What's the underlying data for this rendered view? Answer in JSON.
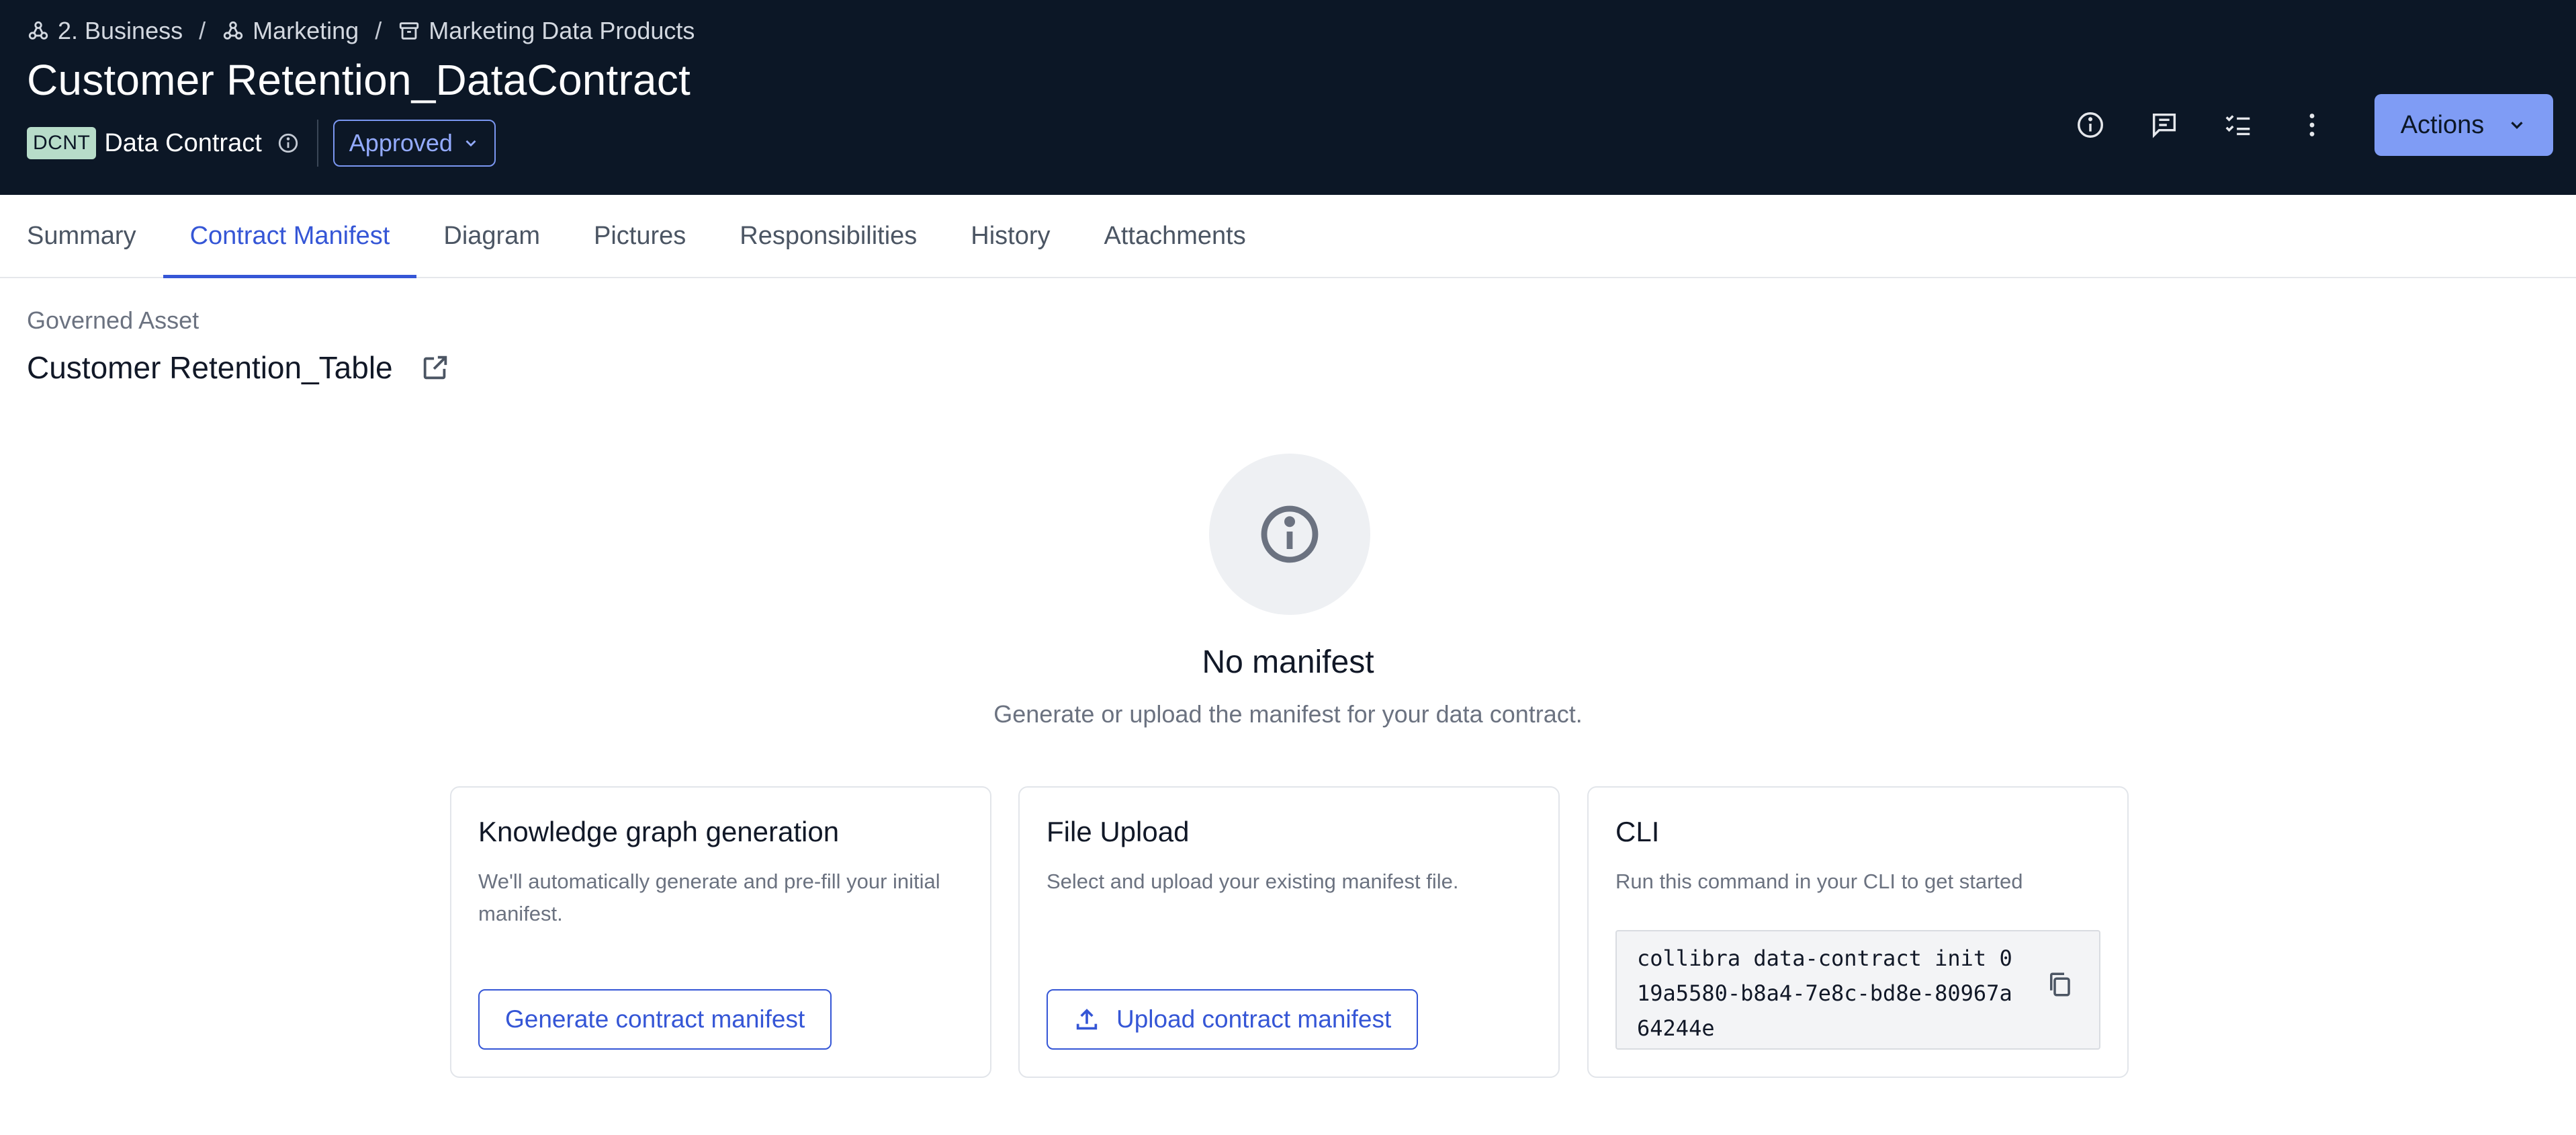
{
  "breadcrumb": [
    {
      "label": "2. Business",
      "icon": "domain-icon"
    },
    {
      "label": "Marketing",
      "icon": "domain-icon"
    },
    {
      "label": "Marketing Data Products",
      "icon": "data-product-icon"
    }
  ],
  "breadcrumb_separator": "/",
  "header": {
    "title": "Customer Retention_DataContract",
    "asset_type_abbr": "DCNT",
    "asset_type": "Data Contract",
    "status": "Approved",
    "actions_label": "Actions",
    "icons": [
      "info-icon",
      "comment-icon",
      "tasks-icon",
      "more-vertical-icon"
    ]
  },
  "tabs": [
    {
      "label": "Summary",
      "active": false
    },
    {
      "label": "Contract Manifest",
      "active": true
    },
    {
      "label": "Diagram",
      "active": false
    },
    {
      "label": "Pictures",
      "active": false
    },
    {
      "label": "Responsibilities",
      "active": false
    },
    {
      "label": "History",
      "active": false
    },
    {
      "label": "Attachments",
      "active": false
    }
  ],
  "governed_asset": {
    "label": "Governed Asset",
    "name": "Customer Retention_Table"
  },
  "empty_state": {
    "title": "No manifest",
    "subtitle": "Generate or upload the manifest for your data contract."
  },
  "cards": {
    "generate": {
      "title": "Knowledge graph generation",
      "description": "We'll automatically generate and pre-fill your initial manifest.",
      "button": "Generate contract manifest"
    },
    "upload": {
      "title": "File Upload",
      "description": "Select and upload your existing manifest file.",
      "button": "Upload contract manifest"
    },
    "cli": {
      "title": "CLI",
      "description": "Run this command in your CLI to get started",
      "command": "collibra data-contract init 019a5580-b8a4-7e8c-bd8e-80967a64244e"
    }
  },
  "colors": {
    "header_bg": "#0c1726",
    "accent": "#3556d6",
    "actions_button": "#7f9cf5",
    "type_badge": "#b7dcc9"
  }
}
